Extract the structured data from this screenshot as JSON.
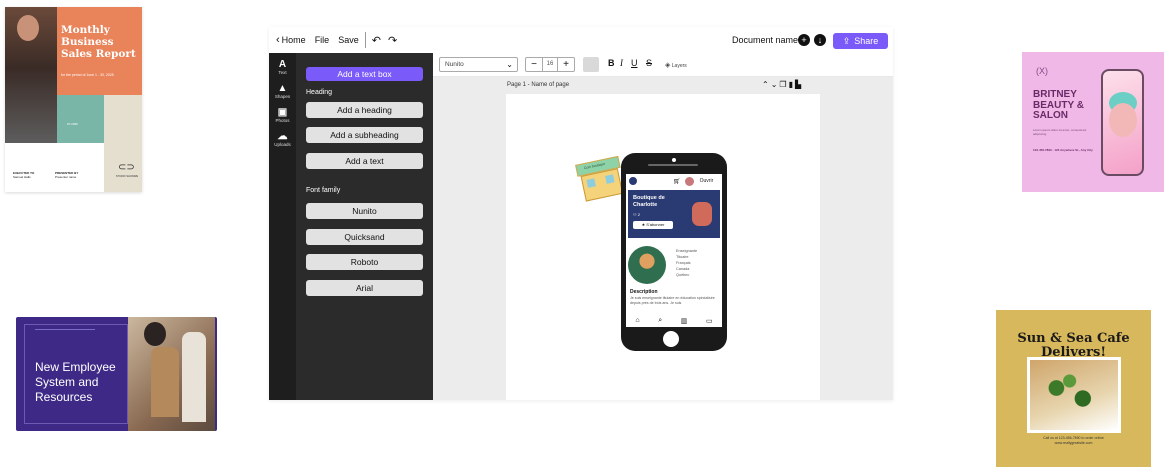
{
  "thumbnails": {
    "sales_report": {
      "title": "Monthly Business Sales Report",
      "subtitle": "for the period of June 1 - 30, 2025",
      "date": "07.2025",
      "executed_by_label": "EXECUTED TO",
      "executed_by_name": "Samuel Halls",
      "presented_by_label": "PRESENTED BY",
      "presented_by_name": "Presenter name",
      "logo_text": "STUDIO SHODWE"
    },
    "employee": {
      "title": "New Employee System and Resources"
    },
    "beauty": {
      "logo": "(X)",
      "title": "BRITNEY BEAUTY & SALON",
      "small_text": "Lorem ipsum dolor sit amet, consectetur adipiscing",
      "contact": "123-456-7890 · 123 Anywhere St., Any City"
    },
    "cafe": {
      "title": "Sun & Sea Cafe Delivers!",
      "contact": "Call us at 123-456-7890 to order online",
      "site": "www.reallygreatsite.com"
    }
  },
  "editor": {
    "topbar": {
      "home_label": "Home",
      "file_label": "File",
      "save_label": "Save",
      "undo_icon": "undo-icon",
      "redo_icon": "redo-icon",
      "document_name": "Document name",
      "share_label": "Share"
    },
    "rail": [
      {
        "icon": "A",
        "label": "Text"
      },
      {
        "icon": "▲",
        "label": "Shapes"
      },
      {
        "icon": "▣",
        "label": "Photos"
      },
      {
        "icon": "☁",
        "label": "Uploads"
      }
    ],
    "panel": {
      "add_textbox": "Add a text box",
      "heading_label": "Heading",
      "add_heading": "Add a heading",
      "add_subheading": "Add a subheading",
      "add_text": "Add a text",
      "font_family_label": "Font family",
      "fonts": [
        "Nunito",
        "Quicksand",
        "Roboto",
        "Arial"
      ]
    },
    "toolbar": {
      "font": "Nunito",
      "size": "16",
      "bold": "B",
      "italic": "I",
      "underline": "U",
      "strike": "S",
      "layers_label": "Layers"
    },
    "page_title": "Page 1 - Name of page",
    "phone": {
      "open_label": "Ouvrir",
      "shop_name": "Boutique de Charlotte",
      "shop_stats": "2",
      "subscribe_label": "S'abonner",
      "tags": [
        "Enseignante",
        "Tituaire",
        "Français",
        "Canada",
        "Québec"
      ],
      "description_title": "Description",
      "description_text": "Je suis enseignante titulaire en éducation spécialisée depuis près de trois ans. Je suis",
      "sticker_label": "Coin boutique"
    }
  }
}
